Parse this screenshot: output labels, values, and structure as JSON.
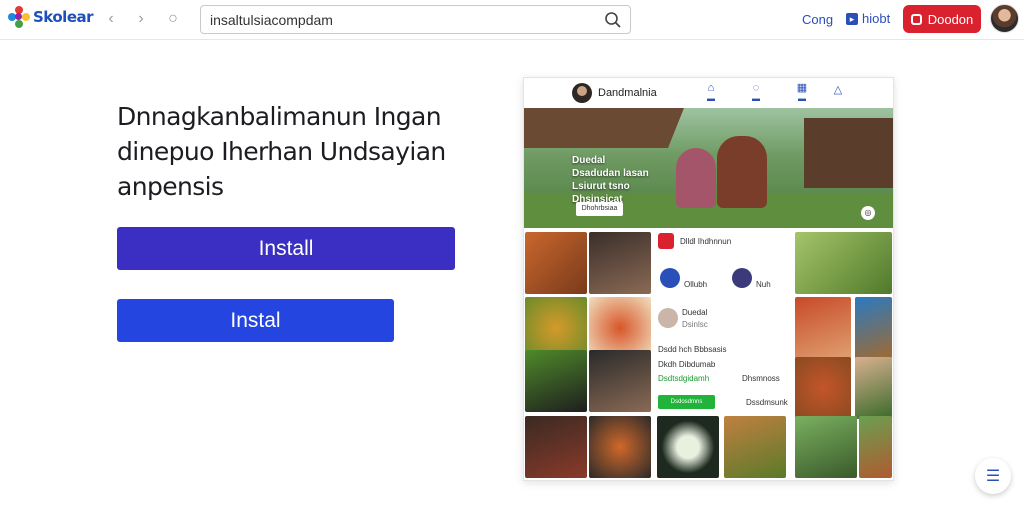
{
  "header": {
    "brand": "Skolear",
    "back_glyph": "‹",
    "forward_glyph": "›",
    "refresh_glyph": "○",
    "search_value": "insaltulsiacompdam",
    "link_cong": "Cong",
    "link_hiobt": "hiobt",
    "red_button_label": "Doodon",
    "colors": {
      "brand": "#1d4fbf",
      "red": "#d9222e",
      "link": "#2b4fb8"
    },
    "icons": [
      "search-icon",
      "back-icon",
      "forward-icon",
      "refresh-icon"
    ]
  },
  "hero": {
    "title_line1": "Dnnagkanbalimanun Ingan",
    "title_line2": "dinepuo Iherhan Undsayian",
    "title_line3": "anpensis",
    "install_primary": "Install",
    "install_secondary": "Instal",
    "colors": {
      "primary": "#3a2fc2",
      "secondary": "#2445e0"
    }
  },
  "preview": {
    "profile_name": "Dandmalnia",
    "banner_text_line1": "Duedal",
    "banner_text_line2": "Dsadudan lasan",
    "banner_text_line3": "Lsiurut tsno",
    "banner_text_line4": "Dhsinsicat",
    "banner_cta": "Dhohrbsiaa",
    "card1_title": "Dlldl Ihdhnnun",
    "card1_row1": "Ollubh",
    "card1_row2": "Nuh",
    "card2_title": "Duedal",
    "card2_sub": "Dsinlsc",
    "card2_line1": "Dsdd hch Bbbsasis",
    "card2_line2": "Dkdh Dibdumab",
    "card2_line3": "Dsdtsdgidamh",
    "card2_line4": "Dhsmnoss",
    "green_button": "Dsdosdmns",
    "card2_link": "Dssdmsunk"
  },
  "fab_icon": "menu-icon"
}
